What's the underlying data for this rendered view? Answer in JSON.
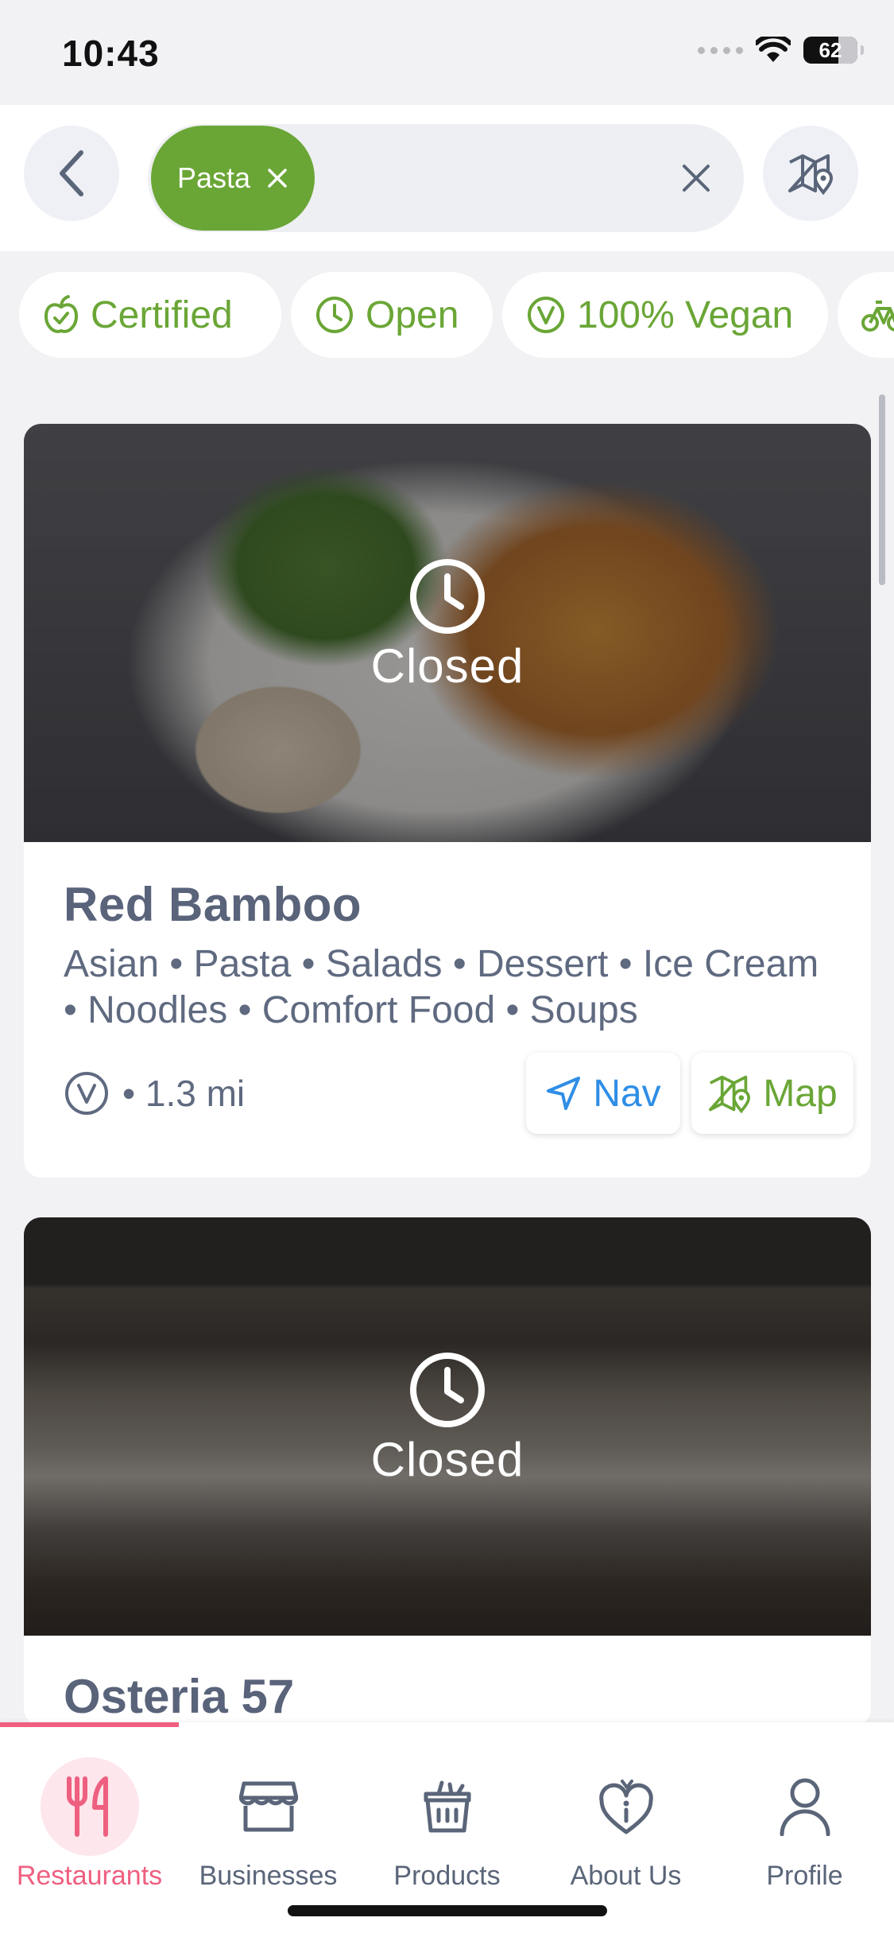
{
  "status_bar": {
    "time": "10:43",
    "battery": "62"
  },
  "search": {
    "chip_label": "Pasta"
  },
  "filters": [
    {
      "label": "Certified",
      "icon": "apple-certified-icon"
    },
    {
      "label": "Open",
      "icon": "clock-icon"
    },
    {
      "label": "100% Vegan",
      "icon": "vegan-v-icon"
    },
    {
      "label": "",
      "icon": "bicycle-icon"
    }
  ],
  "restaurants": [
    {
      "status": "Closed",
      "name": "Red Bamboo",
      "categories": "Asian • Pasta • Salads • Dessert • Ice Cream • Noodles • Comfort Food • Soups",
      "distance": "• 1.3 mi",
      "nav_label": "Nav",
      "map_label": "Map"
    },
    {
      "status": "Closed",
      "name": "Osteria 57"
    }
  ],
  "tabs": [
    {
      "label": "Restaurants",
      "active": true
    },
    {
      "label": "Businesses"
    },
    {
      "label": "Products"
    },
    {
      "label": "About Us"
    },
    {
      "label": "Profile"
    }
  ],
  "colors": {
    "accent_green": "#6aa636",
    "accent_pink": "#ee5f80",
    "nav_blue": "#2f8ee6",
    "text": "#5a6579"
  }
}
